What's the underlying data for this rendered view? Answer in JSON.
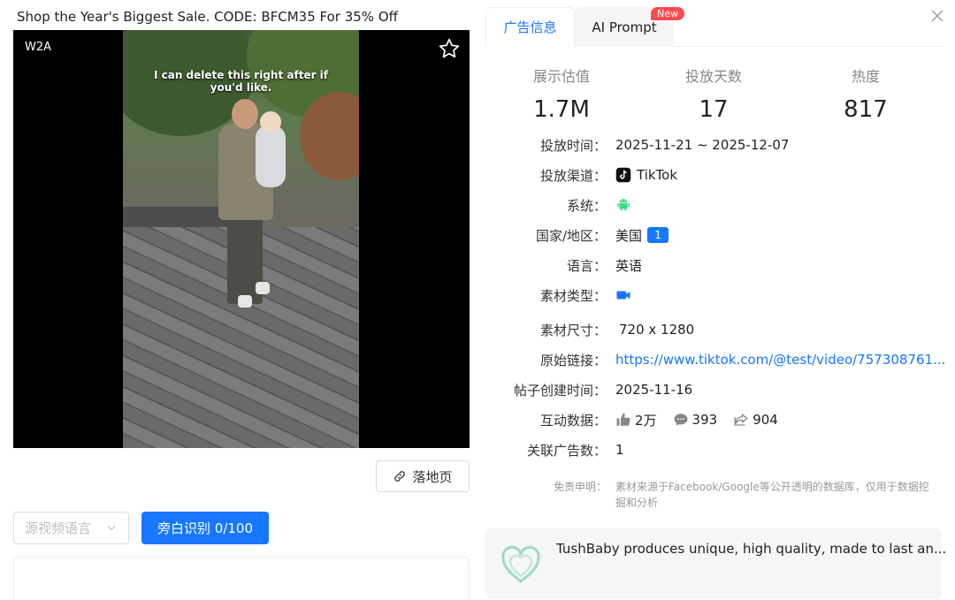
{
  "ad": {
    "title": "Shop the Year's Biggest Sale. CODE: BFCM35 For 35% Off",
    "watermark": "W2A",
    "caption_line1": "I can delete this right after if",
    "caption_line2": "you'd like."
  },
  "left_controls": {
    "landing_page_label": "落地页",
    "language_placeholder": "源视频语言",
    "ocr_button_label": "旁白识别 0/100"
  },
  "tabs": [
    {
      "label": "广告信息",
      "active": true
    },
    {
      "label": "AI Prompt",
      "active": false
    }
  ],
  "new_badge": "New",
  "stats": [
    {
      "label": "展示估值",
      "value": "1.7M"
    },
    {
      "label": "投放天数",
      "value": "17"
    },
    {
      "label": "热度",
      "value": "817"
    }
  ],
  "details": {
    "date_label": "投放时间：",
    "date_value": "2025-11-21 ~ 2025-12-07",
    "channel_label": "投放渠道：",
    "channel_value": "TikTok",
    "system_label": "系统：",
    "system_icon": "android-icon",
    "region_label": "国家/地区：",
    "region_value": "美国",
    "region_count": "1",
    "language_label": "语言：",
    "language_value": "英语",
    "material_type_label": "素材类型：",
    "material_type_icon": "video-camera-icon",
    "size_label": "素材尺寸：",
    "size_value": "720 x 1280",
    "link_label": "原始链接：",
    "link_value": "https://www.tiktok.com/@test/video/757308761...",
    "created_label": "帖子创建时间：",
    "created_value": "2025-11-16",
    "engagement_label": "互动数据：",
    "likes": "2万",
    "comments": "393",
    "shares": "904",
    "related_label": "关联广告数：",
    "related_value": "1"
  },
  "disclaimer": {
    "label": "免责申明：",
    "text": "素材来源于Facebook/Google等公开透明的数据库，仅用于数据挖掘和分析"
  },
  "brand": {
    "description": "TushBaby produces unique, high quality, made to last an..."
  },
  "colors": {
    "accent": "#1677ff",
    "badge_red": "#ff4d4f",
    "android_green": "#3ddc84"
  }
}
